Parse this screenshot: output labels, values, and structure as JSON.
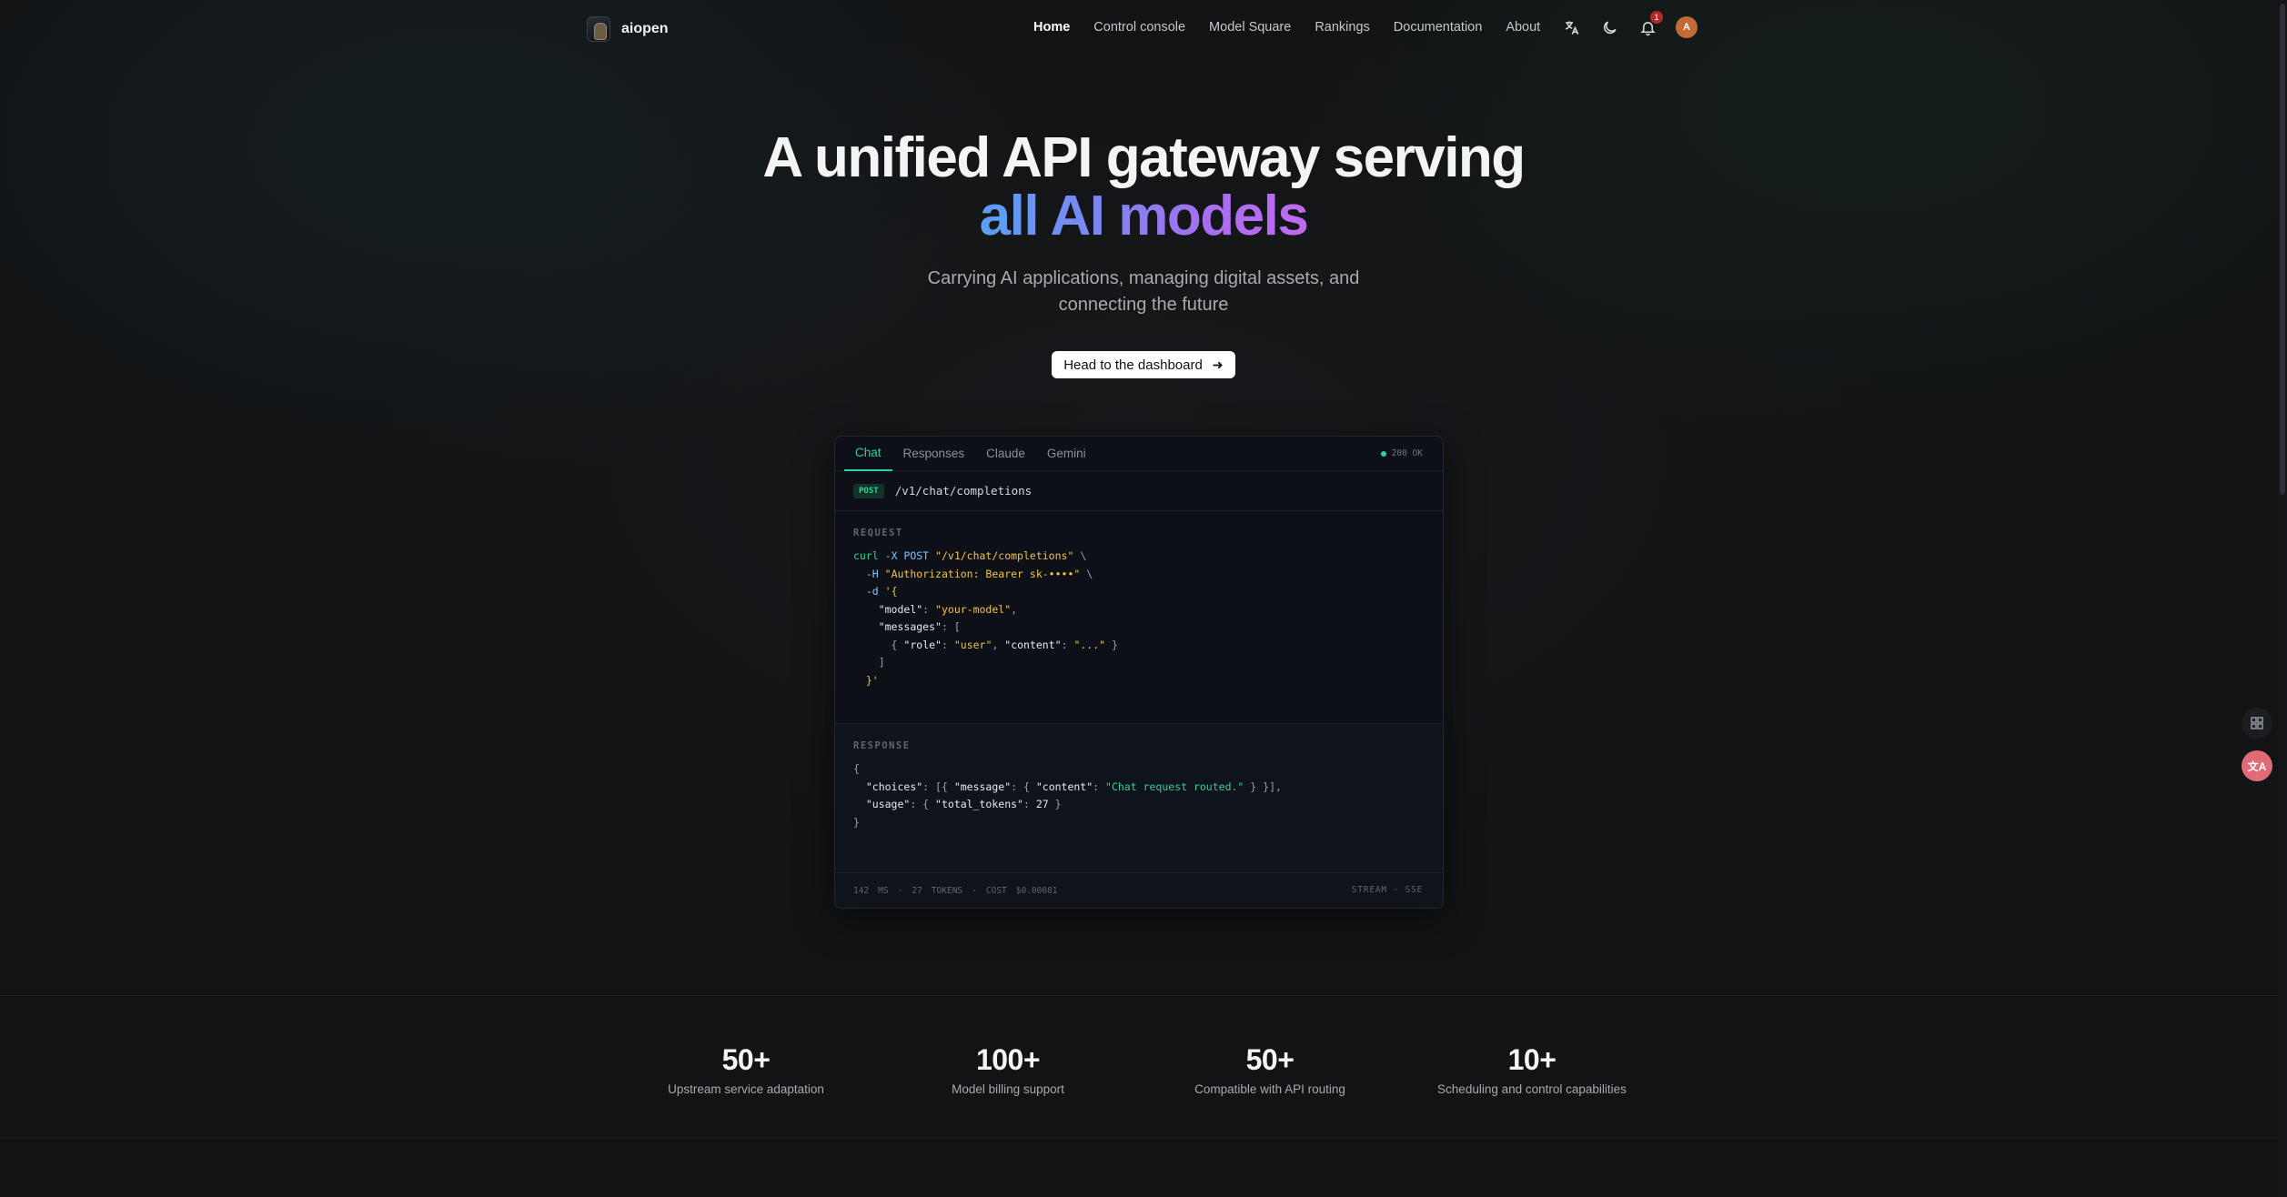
{
  "brand": {
    "name": "aiopen"
  },
  "nav": {
    "links": [
      {
        "label": "Home",
        "active": true
      },
      {
        "label": "Control console",
        "active": false
      },
      {
        "label": "Model Square",
        "active": false
      },
      {
        "label": "Rankings",
        "active": false
      },
      {
        "label": "Documentation",
        "active": false
      },
      {
        "label": "About",
        "active": false
      }
    ],
    "notification_count": "1",
    "avatar_initial": "A"
  },
  "hero": {
    "title_line1": "A unified API gateway serving",
    "title_line2": "all AI models",
    "subtitle_line1": "Carrying AI applications, managing digital assets, and",
    "subtitle_line2": "connecting the future",
    "cta_label": "Head to the dashboard"
  },
  "code_card": {
    "tabs": [
      {
        "label": "Chat",
        "active": true
      },
      {
        "label": "Responses",
        "active": false
      },
      {
        "label": "Claude",
        "active": false
      },
      {
        "label": "Gemini",
        "active": false
      }
    ],
    "status": "200 OK",
    "method": "POST",
    "path": "/v1/chat/completions",
    "request_label": "REQUEST",
    "response_label": "RESPONSE",
    "footer": {
      "latency_value": "142",
      "latency_unit": "MS",
      "tokens_value": "27",
      "tokens_unit": "TOKENS",
      "cost_label": "COST",
      "cost_value": "$0.00081",
      "mode": "STREAM · SSE"
    }
  },
  "stats": [
    {
      "value": "50+",
      "label": "Upstream service adaptation"
    },
    {
      "value": "100+",
      "label": "Model billing support"
    },
    {
      "value": "50+",
      "label": "Compatible with API routing"
    },
    {
      "value": "10+",
      "label": "Scheduling and control capabilities"
    }
  ],
  "colors": {
    "background": "#121315",
    "accent_green": "#2fd39a",
    "gradient_start": "#5aa0f5",
    "gradient_end": "#c06bf0",
    "avatar": "#c46a36"
  }
}
